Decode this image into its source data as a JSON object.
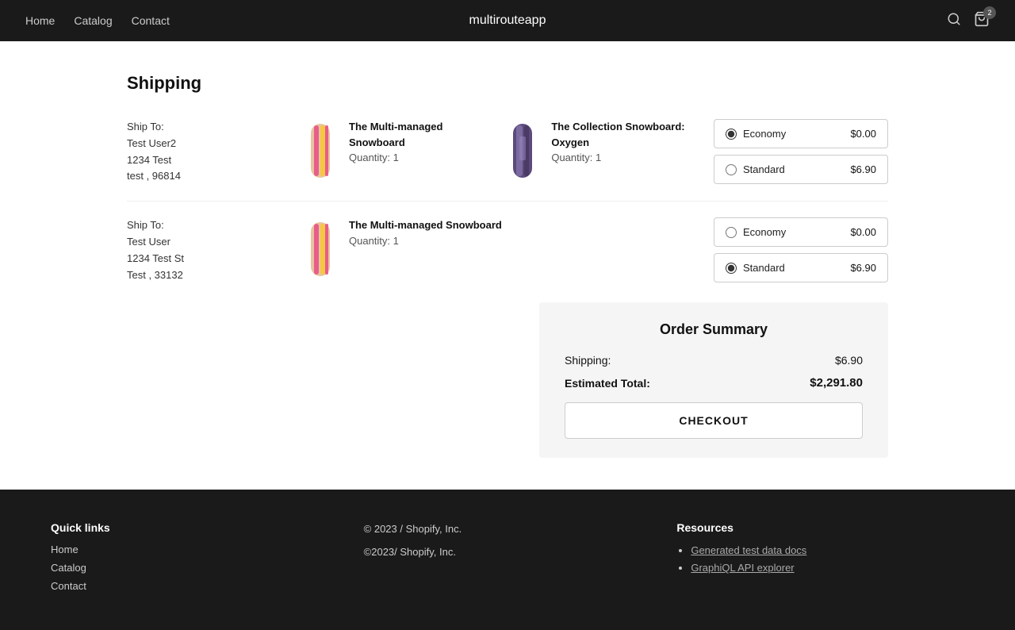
{
  "site": {
    "brand": "multirouteapp"
  },
  "nav": {
    "links": [
      {
        "label": "Home",
        "href": "#"
      },
      {
        "label": "Catalog",
        "href": "#"
      },
      {
        "label": "Contact",
        "href": "#"
      }
    ],
    "cart_count": "2"
  },
  "page": {
    "title": "Shipping"
  },
  "shipping_rows": [
    {
      "id": "row1",
      "address": {
        "label": "Ship To:",
        "name": "Test User2",
        "street": "1234 Test",
        "city_zip": "test , 96814"
      },
      "products": [
        {
          "id": "prod1a",
          "name": "The Multi-managed Snowboard",
          "qty": "Quantity: 1",
          "color": "multi"
        },
        {
          "id": "prod1b",
          "name": "The Collection Snowboard: Oxygen",
          "qty": "Quantity: 1",
          "color": "collection"
        }
      ],
      "options": [
        {
          "id": "r1-economy",
          "label": "Economy",
          "price": "$0.00",
          "selected": true
        },
        {
          "id": "r1-standard",
          "label": "Standard",
          "price": "$6.90",
          "selected": false
        }
      ]
    },
    {
      "id": "row2",
      "address": {
        "label": "Ship To:",
        "name": "Test User",
        "street": "1234 Test St",
        "city_zip": "Test , 33132"
      },
      "products": [
        {
          "id": "prod2a",
          "name": "The Multi-managed Snowboard",
          "qty": "Quantity: 1",
          "color": "multi"
        }
      ],
      "options": [
        {
          "id": "r2-economy",
          "label": "Economy",
          "price": "$0.00",
          "selected": false
        },
        {
          "id": "r2-standard",
          "label": "Standard",
          "price": "$6.90",
          "selected": true
        }
      ]
    }
  ],
  "order_summary": {
    "title": "Order Summary",
    "shipping_label": "Shipping:",
    "shipping_value": "$6.90",
    "total_label": "Estimated Total:",
    "total_value": "$2,291.80",
    "checkout_label": "CHECKOUT"
  },
  "footer": {
    "quick_links_title": "Quick links",
    "quick_links": [
      {
        "label": "Home",
        "href": "#"
      },
      {
        "label": "Catalog",
        "href": "#"
      },
      {
        "label": "Contact",
        "href": "#"
      }
    ],
    "copyright_line1": "© 2023 / Shopify, Inc.",
    "copyright_line2": "©2023/ Shopify, Inc.",
    "resources_title": "Resources",
    "resources": [
      {
        "label": "Generated test data docs",
        "href": "#"
      },
      {
        "label": "GraphiQL API explorer",
        "href": "#"
      }
    ]
  }
}
